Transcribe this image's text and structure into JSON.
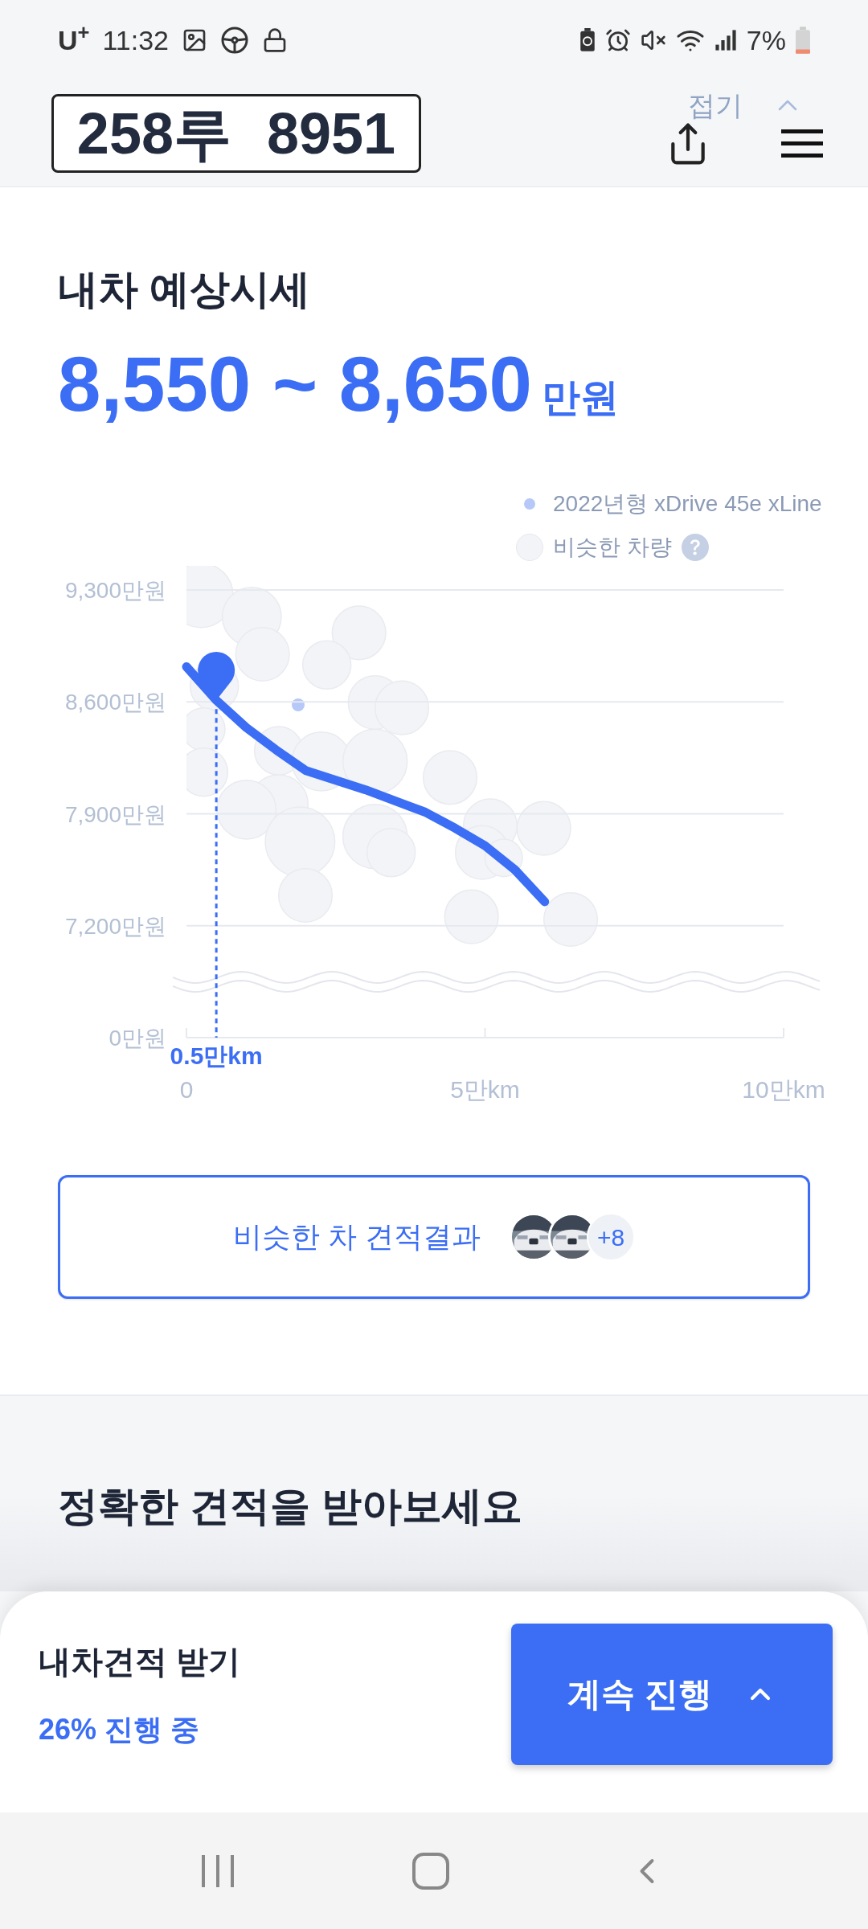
{
  "status_bar": {
    "carrier": "U$^{+}$",
    "time": "11:32",
    "battery": "7%"
  },
  "header": {
    "plate": "258루 8951",
    "collapse": "접기"
  },
  "estimate": {
    "title": "내차 예상시세",
    "price": "8,550 ~ 8,650",
    "unit": "만원"
  },
  "chart": {
    "legend": [
      {
        "kind": "dot",
        "label": "2022년형 xDrive 45e xLine"
      },
      {
        "kind": "bubble",
        "label": "비슷한 차량"
      }
    ],
    "chart_data": {
      "type": "line",
      "x": [
        0,
        0.5,
        1,
        1.5,
        2,
        3,
        3.5,
        4,
        4.5,
        5,
        5.5,
        6
      ],
      "series": [
        {
          "color": "#3b6ef5",
          "values": [
            8820,
            8610,
            8440,
            8300,
            8170,
            8050,
            7980,
            7910,
            7810,
            7700,
            7550,
            7350
          ]
        }
      ],
      "xticks": [
        {
          "value": 0,
          "label": "0"
        },
        {
          "value": 5,
          "label": "5만km"
        },
        {
          "value": 10,
          "label": "10만km"
        }
      ],
      "xlim": [
        0,
        10
      ],
      "grid": true,
      "ylim": [
        6500,
        9300
      ],
      "yticks": [
        {
          "value": 7200,
          "label": "7,200만원"
        },
        {
          "value": 7900,
          "label": "7,900만원"
        },
        {
          "value": 8600,
          "label": "8,600만원"
        },
        {
          "value": 9300,
          "label": "9,300만원"
        }
      ],
      "annotations": [
        {
          "x": 0.5,
          "y": 8610,
          "text": "0.5만km"
        }
      ]
    },
    "axis_floor_label": "0만원"
  },
  "similar": {
    "label": "비슷한 차 견적결과",
    "more": "+8"
  },
  "section": {
    "title": "정확한 견적을 받아보세요"
  },
  "bottom_sheet": {
    "title": "내차견적 받기",
    "progress": "26% 진행 중",
    "button": "계속 진행"
  }
}
